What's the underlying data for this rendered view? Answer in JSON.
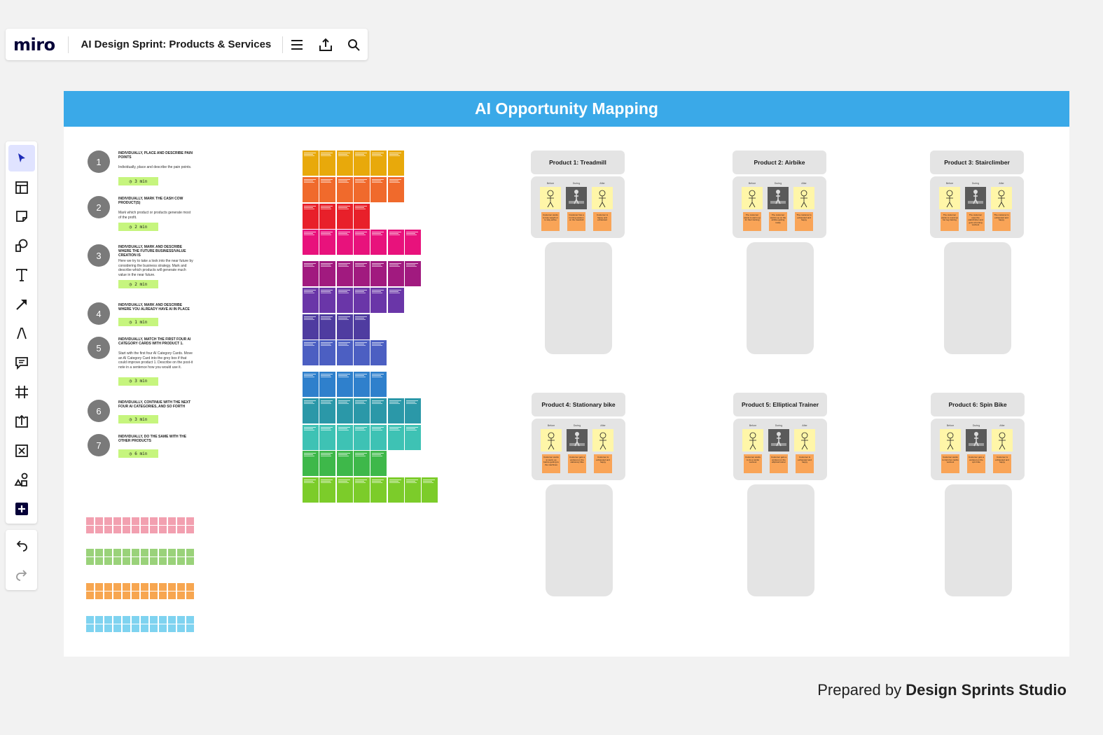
{
  "app": {
    "logo": "miro",
    "board_title": "AI Design Sprint: Products & Services",
    "toolbar_icons": [
      "menu-icon",
      "export-icon",
      "search-icon"
    ]
  },
  "tools": [
    "select-tool",
    "templates-tool",
    "sticky-note-tool",
    "shapes-tool",
    "text-tool",
    "connection-line-tool",
    "pen-tool",
    "comment-tool",
    "frame-tool",
    "upload-tool",
    "crop-tool",
    "apps-tool",
    "more-tool"
  ],
  "history_tools": [
    "undo",
    "redo"
  ],
  "board": {
    "title": "AI Opportunity Mapping",
    "steps": [
      {
        "num": "1",
        "title": "INDIVIDUALLY, PLACE AND DESCRIBE PAIN POINTS",
        "desc": "Individually, place and describe the pain points.",
        "timer": "3 min"
      },
      {
        "num": "2",
        "title": "INDIVIDUALLY, MARK THE CASH COW PRODUCT(S)",
        "desc": "Mark which product or products generate most of the profit.",
        "timer": "2 min"
      },
      {
        "num": "3",
        "title": "INDIVIDUALLY, MARK AND DESCRIBE WHERE THE FUTURE BUSINESS/VALUE CREATION IS",
        "desc": "Here we try to take a look into the near future by considering the business strategy. Mark and describe which products will generate much value in the near future.",
        "timer": "2 min"
      },
      {
        "num": "4",
        "title": "INDIVIDUALLY, MARK AND DESCRIBE WHERE YOU ALREADY HAVE AI IN PLACE",
        "desc": "",
        "timer": "1 min"
      },
      {
        "num": "5",
        "title": "INDIVIDUALLY, MATCH THE FIRST FOUR AI CATEGORY CARDS WITH PRODUCT 1.",
        "desc": "Start with the first four AI Category Cards. Move an AI Category Card into the grey box if that could improve product 1. Describe on the post-it note in a sentence how you would use it.",
        "timer": "3 min"
      },
      {
        "num": "6",
        "title": "INDIVIDUALLY, CONTINUE WITH THE NEXT FOUR AI CATEGORIES, AND SO FORTH",
        "desc": "",
        "timer": "3 min"
      },
      {
        "num": "7",
        "title": "INDIVIDUALLY, DO THE SAME WITH THE OTHER PRODUCTS",
        "desc": "",
        "timer": "6 min"
      }
    ],
    "card_rows": [
      {
        "color": "#e8a90b",
        "count": 6
      },
      {
        "color": "#f06a2c",
        "count": 6
      },
      {
        "color": "#e8202a",
        "count": 4
      },
      {
        "color": "#e8127c",
        "count": 7
      },
      {
        "color": "#a11a7f",
        "count": 7
      },
      {
        "color": "#6a36a8",
        "count": 6
      },
      {
        "color": "#4f3ca0",
        "count": 4
      },
      {
        "color": "#4c5fc2",
        "count": 5
      },
      {
        "color": "#2f80cc",
        "count": 5
      },
      {
        "color": "#2b98a8",
        "count": 7
      },
      {
        "color": "#3ec2b4",
        "count": 7
      },
      {
        "color": "#3eb84a",
        "count": 5
      },
      {
        "color": "#7ccc2a",
        "count": 8
      }
    ],
    "sticky_rows": [
      {
        "color": "#f2a0b0"
      },
      {
        "color": "#9ad27a"
      },
      {
        "color": "#f7a650"
      },
      {
        "color": "#7fd3f0"
      }
    ],
    "column_labels": [
      "Before",
      "During",
      "After"
    ],
    "products": [
      {
        "title": "Product 1: Treadmill",
        "notes": [
          "Customer wants to lose weight or to stay active",
          "Customer has a running session on the treadmill",
          "Customer is happy and exhausted"
        ]
      },
      {
        "title": "Product 2: Airbike",
        "notes": [
          "The customer wants to warm up for their training",
          "The customer warms up on the airbike getting ready",
          "The customer is exhausted and happy"
        ]
      },
      {
        "title": "Product 3: Stairclimber",
        "notes": [
          "The customer wants to round up her leg training",
          "The customer uses the stairclimber and gets a burning workout",
          "The customer is exhausted and happy"
        ]
      },
      {
        "title": "Product 4: Stationary bike",
        "notes": [
          "Customer wants to warm up before getting to the machines",
          "Customer gets a workout on the stationary bike",
          "Customer is exhausted and happy"
        ]
      },
      {
        "title": "Product 5: Elliptical Trainer",
        "notes": [
          "Customer wants to do a cardio workout",
          "Customer gets a workout on the elliptical trainer",
          "Customer is exhausted and happy"
        ]
      },
      {
        "title": "Product 6: Spin Bike",
        "notes": [
          "Customer wants to train her cardio workout",
          "Customer gets a workout on the spin bike",
          "Customer is exhausted and happy"
        ]
      }
    ]
  },
  "credit": {
    "prefix": "Prepared by ",
    "name": "Design Sprints Studio"
  }
}
